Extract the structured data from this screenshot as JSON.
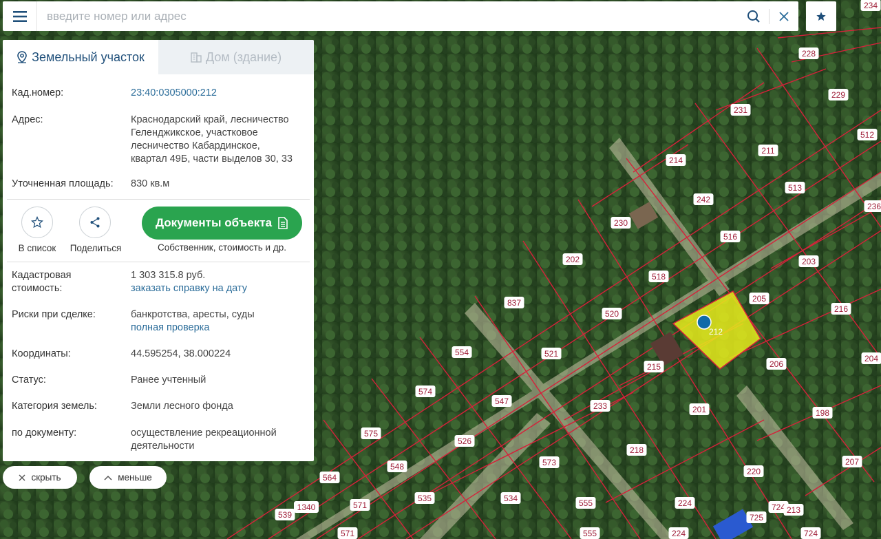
{
  "search": {
    "placeholder": "введите номер или адрес"
  },
  "icons": {
    "menu": "hamburger-icon",
    "search": "magnifier-icon",
    "clear": "close-icon",
    "favorite": "star-icon",
    "land": "map-pin-icon",
    "building": "building-icon",
    "add_to_list": "star-outline-icon",
    "share": "share-icon",
    "document": "document-icon",
    "hide": "close-icon",
    "less": "chevron-up-icon"
  },
  "colors": {
    "accent": "#2aa44f",
    "link": "#2c6d9a",
    "parcel_border": "#d6213a",
    "selected_parcel": "#e8ec1c",
    "marker": "#0f6aa8"
  },
  "tabs": [
    {
      "label": "Земельный участок",
      "active": true
    },
    {
      "label": "Дом (здание)",
      "active": false
    }
  ],
  "info": {
    "cad_number_label": "Кад.номер:",
    "cad_number_value": "23:40:0305000:212",
    "address_label": "Адрес:",
    "address_value": "Краснодарский край, лесничество Геленджикское, участковое лесничество Кабардинское, квартал 49Б, части выделов 30, 33",
    "area_label": "Уточненная площадь:",
    "area_value": "830 кв.м",
    "cad_cost_label": "Кадастровая стоимость:",
    "cad_cost_value": "1 303 315.8 руб.",
    "cad_cost_link": "заказать справку на дату",
    "risks_label": "Риски при сделке:",
    "risks_value": "банкротства, аресты, суды",
    "risks_link": "полная проверка",
    "coords_label": "Координаты:",
    "coords_value": "44.595254, 38.000224",
    "status_label": "Статус:",
    "status_value": "Ранее учтенный",
    "category_label": "Категория земель:",
    "category_value": "Земли лесного фонда",
    "by_doc_label": "по документу:",
    "by_doc_value": "осуществление рекреационной деятельности"
  },
  "actions": {
    "add_to_list": "В список",
    "share": "Поделиться",
    "docs_button": "Документы объекта",
    "docs_sub": "Собственник, стоимость и др."
  },
  "bottom": {
    "hide": "скрыть",
    "less": "меньше"
  },
  "map": {
    "selected_label": "212",
    "parcel_labels": [
      "228",
      "234",
      "229",
      "231",
      "211",
      "512",
      "214",
      "513",
      "242",
      "236",
      "230",
      "516",
      "203",
      "202",
      "518",
      "205",
      "216",
      "837",
      "520",
      "554",
      "521",
      "215",
      "206",
      "204",
      "574",
      "547",
      "233",
      "201",
      "198",
      "575",
      "526",
      "218",
      "573",
      "220",
      "207",
      "564",
      "548",
      "535",
      "534",
      "555",
      "224",
      "539",
      "1340",
      "571",
      "725",
      "724",
      "213",
      "571",
      "555",
      "224",
      "724"
    ]
  }
}
